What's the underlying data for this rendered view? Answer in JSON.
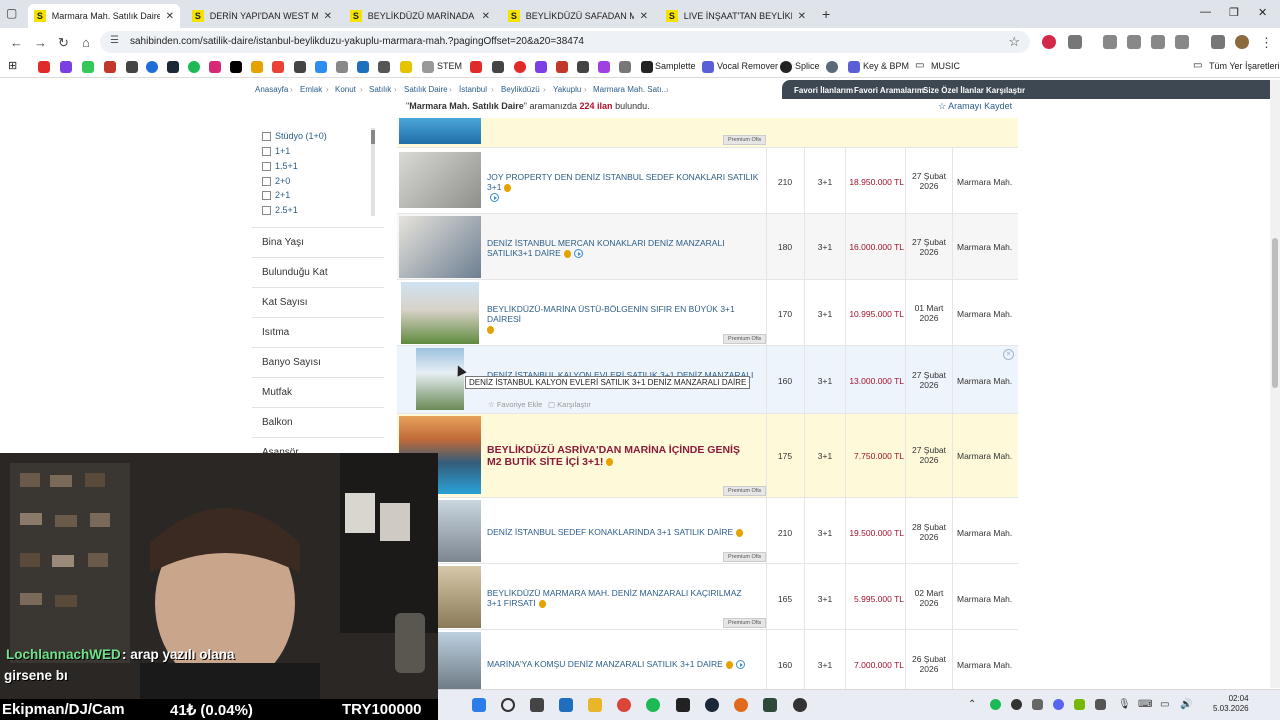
{
  "browser": {
    "tabs": [
      {
        "label": "Marmara Mah. Satılık Daire İlanları",
        "active": true
      },
      {
        "label": "DERİN YAPI'DAN WEST MARİNA",
        "active": false
      },
      {
        "label": "BEYLİKDÜZÜ MARİNADA GÜVE",
        "active": false
      },
      {
        "label": "BEYLİKDÜZÜ SAFADAN MARİNA",
        "active": false
      },
      {
        "label": "LIVE İNŞAAT'TAN BEYLİKDÜZÜ",
        "active": false
      }
    ],
    "tab_favicon_letter": "S",
    "url": "sahibinden.com/satilik-daire/istanbul-beylikduzu-yakuplu-marmara-mah.?pagingOffset=20&a20=38474",
    "bookmarks": [
      "STEM",
      "Samplette",
      "Vocal Remover",
      "Splice",
      "Key & BPM",
      "MUSIC",
      "Tüm Yer İşaretleri"
    ]
  },
  "breadcrumb": [
    "Anasayfa",
    "Emlak",
    "Konut",
    "Satılık",
    "Satılık Daire",
    "İstanbul",
    "Beylikdüzü",
    "Yakuplu",
    "Marmara Mah. Satı..."
  ],
  "topnav": [
    "Favori İlanlarım",
    "Favori Aramalarım",
    "Size Özel İlanlar",
    "Karşılaştır"
  ],
  "result": {
    "query": "Marmara Mah. Satılık Daire",
    "pre": "aramanızda",
    "count": "224 ilan",
    "post": "bulundu.",
    "save_search": "Aramayı Kaydet"
  },
  "filters": {
    "rooms": [
      "Stüdyo (1+0)",
      "1+1",
      "1.5+1",
      "2+0",
      "2+1",
      "2.5+1"
    ],
    "facets": [
      "Bina Yaşı",
      "Bulunduğu Kat",
      "Kat Sayısı",
      "Isıtma",
      "Banyo Sayısı",
      "Mutfak",
      "Balkon",
      "Asansör"
    ]
  },
  "listings": [
    {
      "title": "JOY PROPERTY DEN DENİZ İSTANBUL SEDEF KONAKLARI SATILIK 3+1",
      "m2": "210",
      "rooms": "3+1",
      "price": "18.950.000 TL",
      "date1": "27 Şubat",
      "date2": "2026",
      "location": "Marmara Mah."
    },
    {
      "title": "DENİZ İSTANBUL MERCAN KONAKLARI DENİZ MANZARALI SATILIK3+1 DAİRE",
      "m2": "180",
      "rooms": "3+1",
      "price": "16.000.000 TL",
      "date1": "27 Şubat",
      "date2": "2026",
      "location": "Marmara Mah."
    },
    {
      "title": "BEYLİKDÜZÜ-MARİNA ÜSTÜ-BÖLGENİN SIFIR EN BÜYÜK 3+1 DAİRESİ",
      "m2": "170",
      "rooms": "3+1",
      "price": "10.995.000 TL",
      "date1": "01 Mart",
      "date2": "2026",
      "location": "Marmara Mah."
    },
    {
      "title": "DENİZ İSTANBUL KALYON EVLERİ SATILIK 3+1 DENİZ MANZARALI DAİRE",
      "m2": "160",
      "rooms": "3+1",
      "price": "13.000.000 TL",
      "date1": "27 Şubat",
      "date2": "2026",
      "location": "Marmara Mah."
    },
    {
      "title": "BEYLİKDÜZÜ ASRİVA'DAN MARİNA İÇİNDE GENİŞ M2 BUTİK SİTE İÇİ 3+1!",
      "m2": "175",
      "rooms": "3+1",
      "price": "7.750.000 TL",
      "date1": "27 Şubat",
      "date2": "2026",
      "location": "Marmara Mah."
    },
    {
      "title": "DENİZ İSTANBUL SEDEF KONAKLARINDA 3+1 SATILIK DAİRE",
      "m2": "210",
      "rooms": "3+1",
      "price": "19.500.000 TL",
      "date1": "28 Şubat",
      "date2": "2026",
      "location": "Marmara Mah."
    },
    {
      "title": "BEYLİKDÜZÜ MARMARA MAH. DENİZ MANZARALI KAÇIRILMAZ 3+1 FIRSATI",
      "m2": "165",
      "rooms": "3+1",
      "price": "5.995.000 TL",
      "date1": "02 Mart",
      "date2": "2026",
      "location": "Marmara Mah."
    },
    {
      "title": "MARİNA'YA KOMŞU DENİZ MANZARALI SATILIK 3+1 DAİRE",
      "m2": "160",
      "rooms": "3+1",
      "price": "7.000.000 TL",
      "date1": "26 Şubat",
      "date2": "2026",
      "location": "Marmara Mah."
    }
  ],
  "premium_badge": "Premium Ofis",
  "hover_row": {
    "tooltip": "DENİZ İSTANBUL KALYON EVLERİ SATILIK 3+1 DENİZ MANZARALI DAİRE",
    "fav": "Favoriye Ekle",
    "compare": "Karşılaştır"
  },
  "stream": {
    "chat_user": "LochlannachWED",
    "chat_text": ": arap yazılı olana",
    "chat_line2": "girsene bı",
    "ticker_left": "Ekipman/DJ/Cam",
    "ticker_mid": "41₺ (0.04%)",
    "ticker_right": "TRY100000"
  },
  "clock": {
    "time": "02:04",
    "date": "5.03.2026"
  },
  "colors": {
    "brand_yellow": "#f6e200",
    "link": "#2b5e8a",
    "price": "#a4112c",
    "premium_bg": "#fefad9"
  }
}
